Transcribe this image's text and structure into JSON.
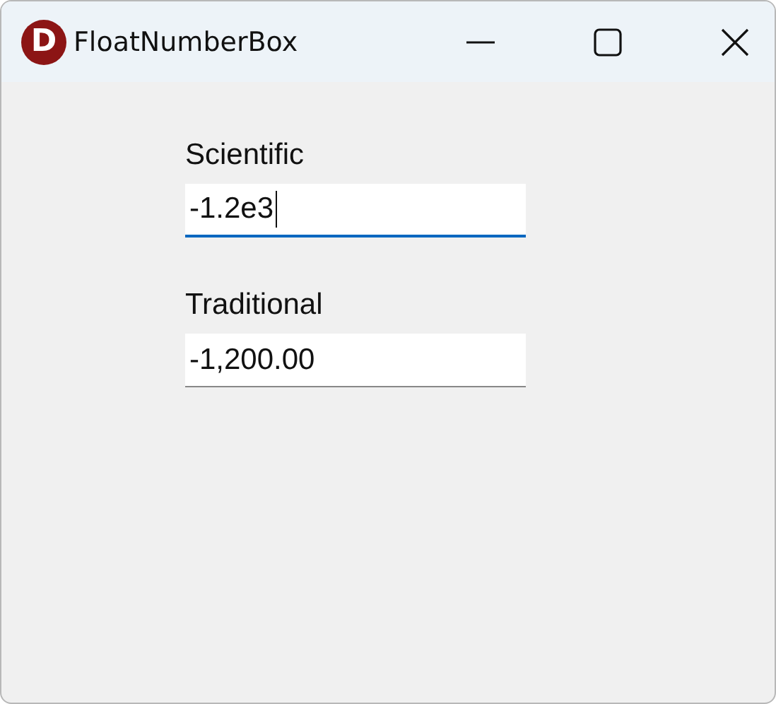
{
  "window": {
    "title": "FloatNumberBox",
    "logo_letter": "D"
  },
  "fields": [
    {
      "label": "Scientific",
      "value": "-1.2e3",
      "focused": true
    },
    {
      "label": "Traditional",
      "value": "-1,200.00",
      "focused": false
    }
  ]
}
